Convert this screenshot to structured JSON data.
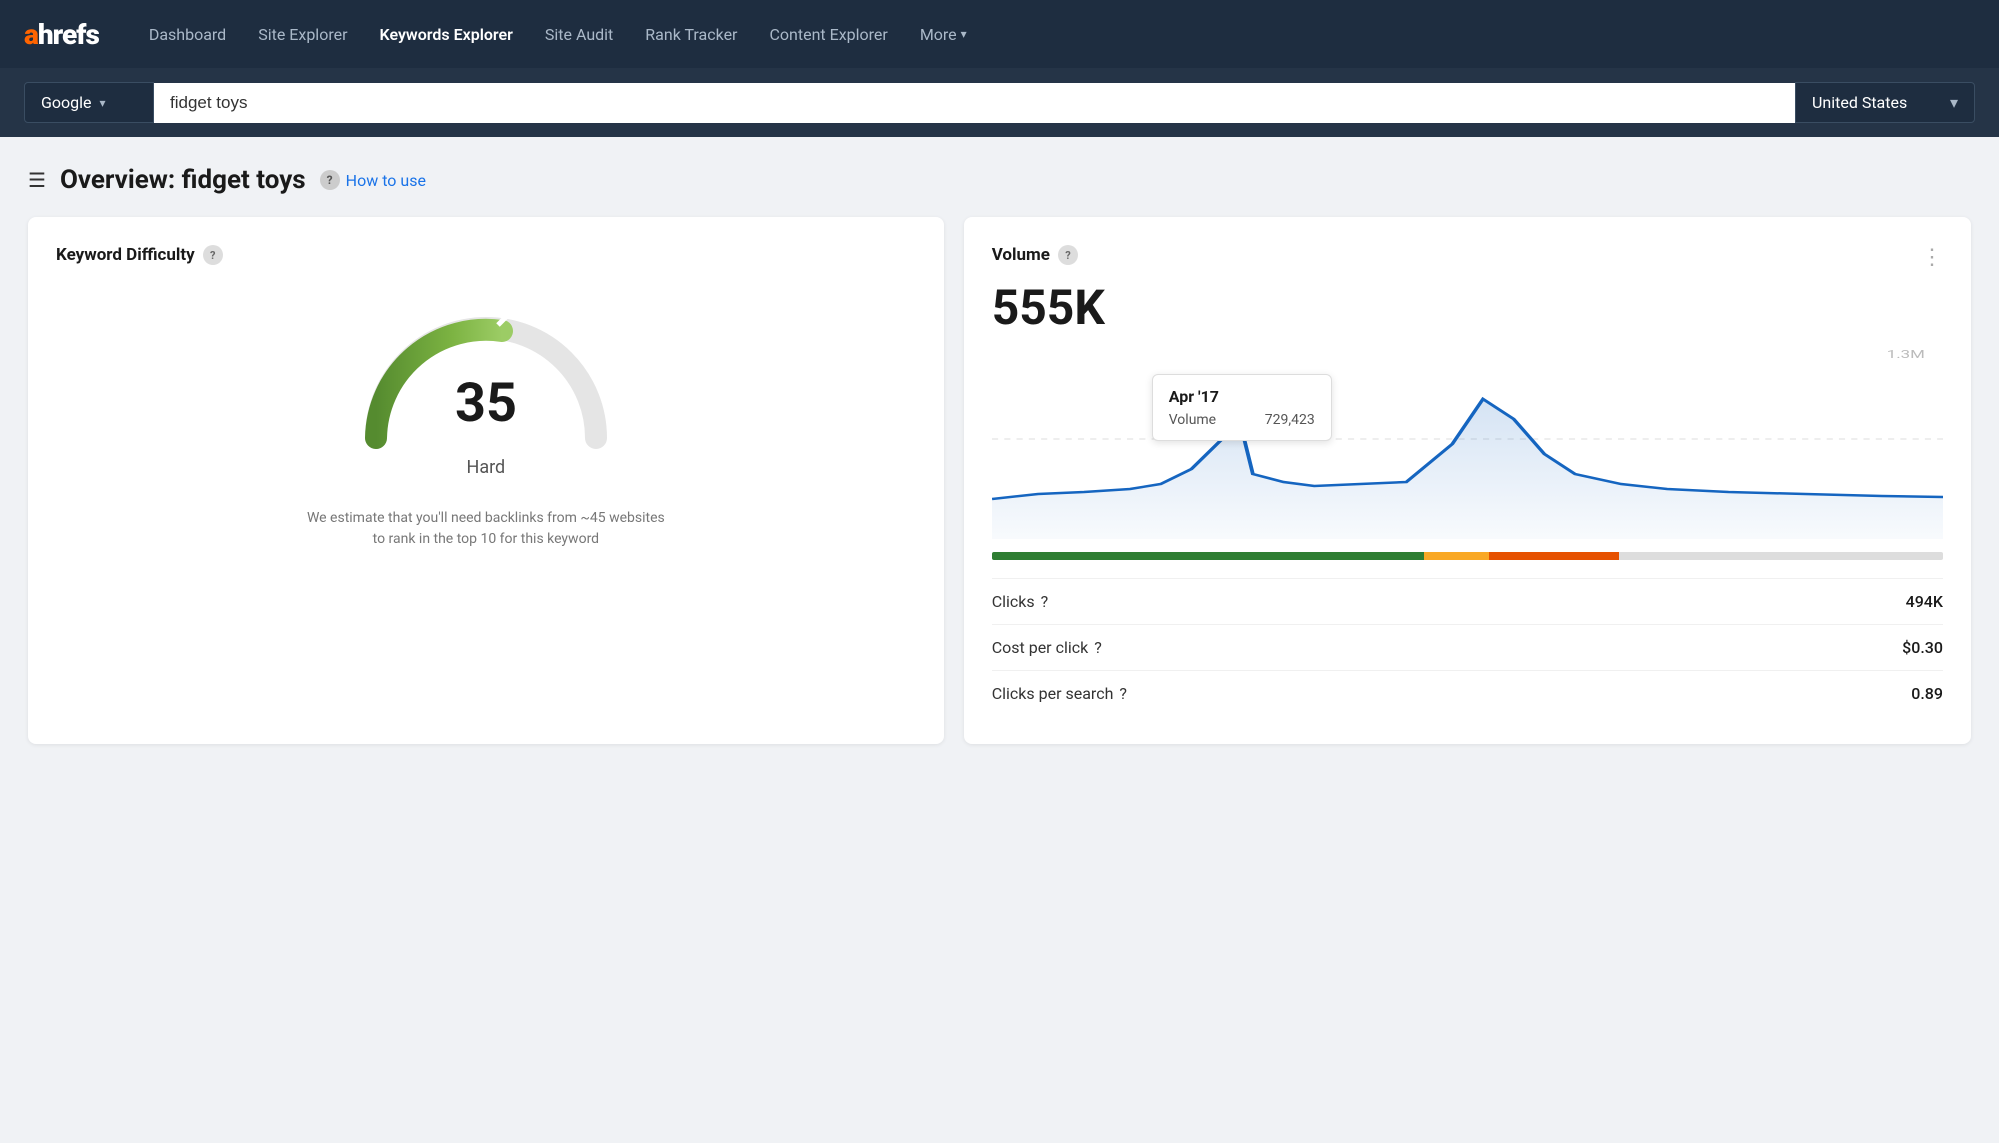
{
  "brand": {
    "logo_text": "ahrefs"
  },
  "nav": {
    "links": [
      {
        "id": "dashboard",
        "label": "Dashboard",
        "active": false
      },
      {
        "id": "site-explorer",
        "label": "Site Explorer",
        "active": false
      },
      {
        "id": "keywords-explorer",
        "label": "Keywords Explorer",
        "active": true
      },
      {
        "id": "site-audit",
        "label": "Site Audit",
        "active": false
      },
      {
        "id": "rank-tracker",
        "label": "Rank Tracker",
        "active": false
      },
      {
        "id": "content-explorer",
        "label": "Content Explorer",
        "active": false
      }
    ],
    "more_label": "More"
  },
  "searchbar": {
    "engine": "Google",
    "query": "fidget toys",
    "country": "United States"
  },
  "page": {
    "overview_title": "Overview: fidget toys",
    "how_to_use_label": "How to use"
  },
  "kd_card": {
    "title": "Keyword Difficulty",
    "score": "35",
    "label": "Hard",
    "description": "We estimate that you'll need backlinks from ~45 websites\nto rank in the top 10 for this keyword"
  },
  "volume_card": {
    "title": "Volume",
    "value": "555K",
    "y_max_label": "1.3M",
    "tooltip": {
      "date": "Apr '17",
      "label": "Volume",
      "value": "729,423"
    },
    "metrics": [
      {
        "id": "clicks",
        "label": "Clicks",
        "value": "494K"
      },
      {
        "id": "cpc",
        "label": "Cost per click",
        "value": "$0.30"
      },
      {
        "id": "cps",
        "label": "Clicks per search",
        "value": "0.89"
      }
    ]
  },
  "icons": {
    "hamburger": "☰",
    "question": "?",
    "arrow_down": "▾",
    "three_dots": "⋮"
  }
}
